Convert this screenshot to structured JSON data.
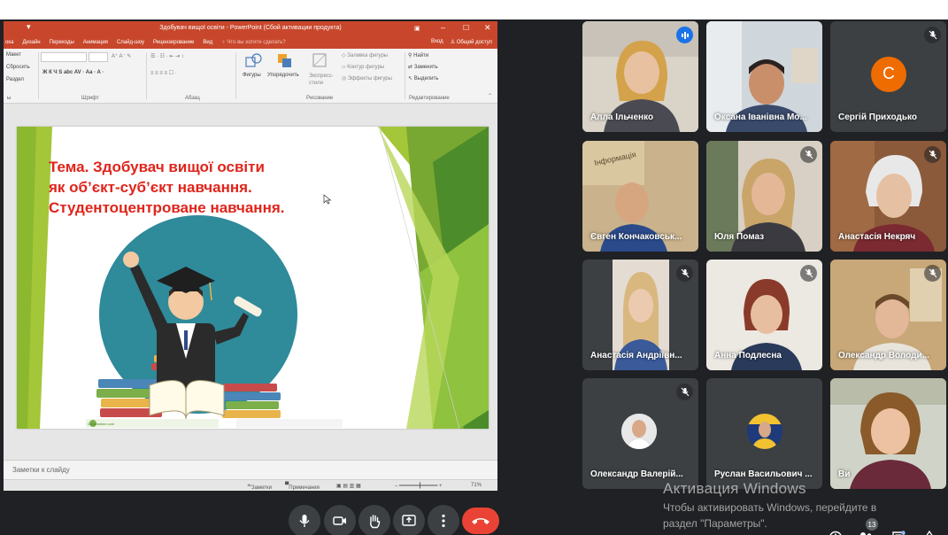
{
  "powerpoint": {
    "title": "Здобувач вищої освіти - PowerPoint (Сбой активации продукта)",
    "tabs": [
      "ока",
      "Дизайн",
      "Переходы",
      "Анимация",
      "Слайд-шоу",
      "Рецензирование",
      "Вид"
    ],
    "tell_me": "Что вы хотите сделать?",
    "sign_in": "Вход",
    "share": "Общий доступ",
    "ribbon": {
      "layout": "Макет",
      "reset": "Сбросить",
      "section": "Раздел",
      "slides_group": "ы",
      "font_group": "Шрифт",
      "paragraph_group": "Абзац",
      "shapes": "Фигуры",
      "arrange": "Упорядочить",
      "quick_styles": "Экспресс-стили",
      "fill": "Заливка фигуры",
      "outline": "Контур фигуры",
      "effects": "Эффекты фигуры",
      "drawing_group": "Рисование",
      "find": "Найти",
      "replace": "Заменить",
      "select": "Выделить",
      "editing_group": "Редактирование"
    },
    "slide": {
      "title_lines": [
        "Тема.   Здобувач вищої освіти",
        "як об’єкт-суб’єкт навчання.",
        "Студентоцентроване навчання."
      ],
      "footer": "Dreamstime.com"
    },
    "notes_placeholder": "Заметки к слайду",
    "status": {
      "notes": "Заметки",
      "comments": "Примечания",
      "zoom": "71%"
    }
  },
  "participants": [
    {
      "name": "Алла Ільченко",
      "speaking": true
    },
    {
      "name": "Оксана Іванівна Мо...",
      "muted": false
    },
    {
      "name": "Сергій Приходько",
      "initial": "С",
      "avatar_color": "#ef6c00",
      "muted": true
    },
    {
      "name": "Євген Кончаковськ...",
      "muted": false
    },
    {
      "name": "Юля Помаз",
      "muted": true
    },
    {
      "name": "Анастасія Некряч",
      "muted": true
    },
    {
      "name": "Анастасія Андріївн...",
      "muted": true
    },
    {
      "name": "Анна Подлесна",
      "muted": true
    },
    {
      "name": "Олександр Володи...",
      "muted": true
    },
    {
      "name": "Олександр Валерій...",
      "muted": true
    },
    {
      "name": "Руслан Васильович ...",
      "muted": false
    },
    {
      "name": "Ви",
      "muted": false
    }
  ],
  "controls": {
    "participants_count": "13"
  },
  "watermark": {
    "title": "Активация Windows",
    "line1": "Чтобы активировать Windows, перейдите в",
    "line2": "раздел \"Параметры\"."
  },
  "colors": {
    "ppt_accent": "#c8472c",
    "meet_bg": "#202124",
    "end_call": "#ea4335",
    "slide_title": "#e0241b"
  }
}
